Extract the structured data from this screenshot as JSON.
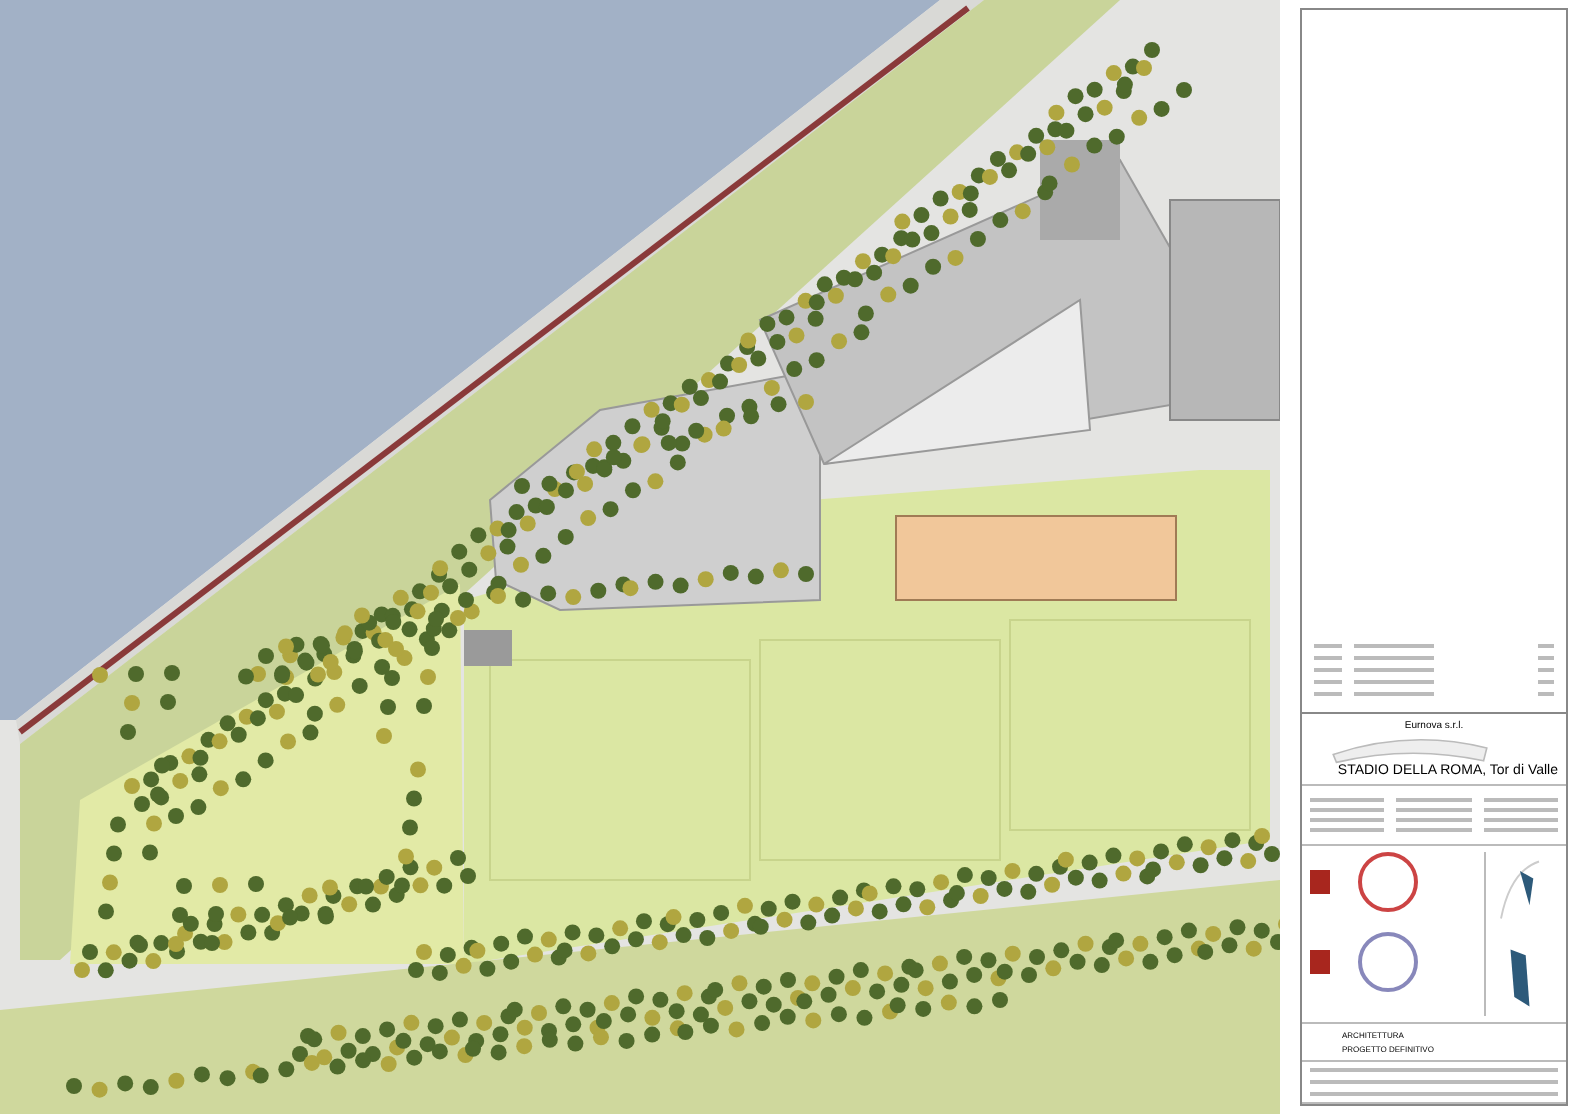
{
  "title_block": {
    "client": "Eurnova s.r.l.",
    "project": "STADIO DELLA ROMA, Tor di Valle",
    "discipline": "ARCHITETTURA",
    "phase": "PROGETTO DEFINITIVO"
  }
}
